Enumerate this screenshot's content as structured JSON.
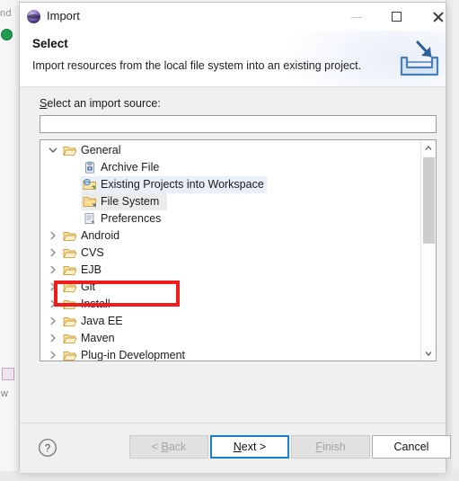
{
  "window": {
    "title": "Import",
    "app_icon": "eclipse-sphere-icon",
    "controls": {
      "minimize": "minimize-icon",
      "maximize": "maximize-icon",
      "close": "close-icon"
    }
  },
  "header": {
    "title": "Select",
    "description": "Import resources from the local file system into an existing project.",
    "icon": "import-tray-arrow-icon"
  },
  "body": {
    "source_label_mnemonic": "S",
    "source_label_rest": "elect an import source:",
    "filter": {
      "value": "",
      "placeholder": ""
    },
    "tree": [
      {
        "label": "General",
        "depth": 0,
        "expanded": true,
        "icon": "folder-open-icon",
        "state": "none"
      },
      {
        "label": "Archive File",
        "depth": 1,
        "expanded": null,
        "icon": "archive-file-icon",
        "state": "none"
      },
      {
        "label": "Existing Projects into Workspace",
        "depth": 1,
        "expanded": null,
        "icon": "projects-import-icon",
        "state": "selected"
      },
      {
        "label": "File System",
        "depth": 1,
        "expanded": null,
        "icon": "folder-arrow-icon",
        "state": "hover"
      },
      {
        "label": "Preferences",
        "depth": 1,
        "expanded": null,
        "icon": "preferences-icon",
        "state": "none"
      },
      {
        "label": "Android",
        "depth": 0,
        "expanded": false,
        "icon": "folder-open-icon",
        "state": "none"
      },
      {
        "label": "CVS",
        "depth": 0,
        "expanded": false,
        "icon": "folder-open-icon",
        "state": "none"
      },
      {
        "label": "EJB",
        "depth": 0,
        "expanded": false,
        "icon": "folder-open-icon",
        "state": "none"
      },
      {
        "label": "Git",
        "depth": 0,
        "expanded": false,
        "icon": "folder-open-icon",
        "state": "none"
      },
      {
        "label": "Install",
        "depth": 0,
        "expanded": false,
        "icon": "folder-open-icon",
        "state": "none"
      },
      {
        "label": "Java EE",
        "depth": 0,
        "expanded": false,
        "icon": "folder-open-icon",
        "state": "none"
      },
      {
        "label": "Maven",
        "depth": 0,
        "expanded": false,
        "icon": "folder-open-icon",
        "state": "none"
      },
      {
        "label": "Plug-in Development",
        "depth": 0,
        "expanded": false,
        "icon": "folder-open-icon",
        "state": "none"
      }
    ],
    "scrollbar": {
      "up_arrow": "chevron-up-icon",
      "down_arrow": "chevron-down-icon"
    },
    "annotation": {
      "target": "File System",
      "color": "#f01c1c"
    }
  },
  "footer": {
    "help": "?",
    "buttons": {
      "back": {
        "prefix": "< ",
        "mnemonic": "B",
        "suffix": "ack",
        "enabled": false,
        "default": false
      },
      "next": {
        "prefix": "",
        "mnemonic": "N",
        "suffix": "ext >",
        "enabled": true,
        "default": true
      },
      "finish": {
        "prefix": "",
        "mnemonic": "F",
        "suffix": "inish",
        "enabled": false,
        "default": false
      },
      "cancel": {
        "prefix": "",
        "mnemonic": "",
        "suffix": "Cancel",
        "enabled": true,
        "default": false
      }
    }
  },
  "background": {
    "left_text": "nd",
    "bottom_text": "w"
  }
}
